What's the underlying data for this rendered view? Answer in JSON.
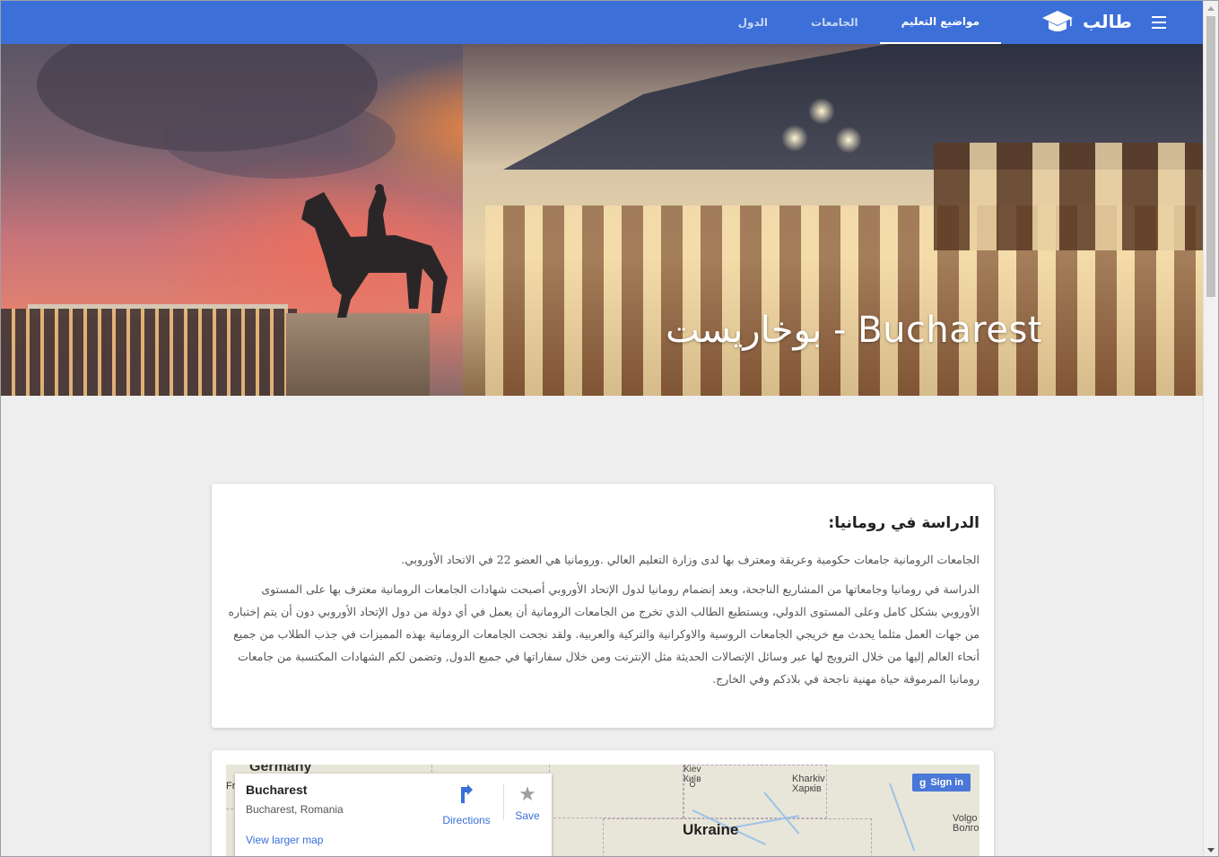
{
  "app": {
    "brand": "طالب",
    "tabs": [
      {
        "label": "مواضيع التعليم",
        "active": true
      },
      {
        "label": "الجامعات",
        "active": false
      },
      {
        "label": "الدول",
        "active": false
      }
    ]
  },
  "hero": {
    "title": "بوخاريست - Bucharest"
  },
  "article": {
    "heading": "الدراسة في رومانيا:",
    "paragraphs": [
      "الجامعات الرومانية جامعات حكومية وعريقة ومعترف بها لدى وزارة التعليم العالي .ورومانيا هي العضو 22 في الاتحاد الأوروبي.",
      "الدراسة في رومانيا وجامعاتها من المشاريع الناجحة، وبعد إنضمام رومانيا لدول الإتحاد الأوروبي أصبحت شهادات الجامعات الرومانية معترف بها على المستوى الأوروبي بشكل كامل وعلى المستوى الدولي، ويستطيع الطالب الذي تخرج من الجامعات الرومانية أن يعمل في أي دولة من دول الإتحاد الأوروبي دون أن يتم إختباره من جهات العمل مثلما يحدث مع خريجي الجامعات الروسية والاوكرانية والتركية والعربية. ولقد نجحت الجامعات الرومانية بهذه المميزات في جذب الطلاب من جميع أنحاء العالم إليها من خلال الترويج لها عبر وسائل الإتصالات الحديثة مثل الإنترنت ومن خلال سفاراتها في جميع الدول, وتضمن لكم الشهادات المكتسبة من جامعات رومانيا المرموقة حياة مهنية ناجحة في بلادكم وفي الخارج."
    ]
  },
  "map": {
    "place_name": "Bucharest",
    "place_address": "Bucharest, Romania",
    "view_larger": "View larger map",
    "directions_label": "Directions",
    "save_label": "Save",
    "signin_label": "Sign in",
    "labels": {
      "germany": "Germany",
      "fr": "Fr",
      "ukraine": "Ukraine",
      "kiev": "Kiev",
      "kiev_local": "Київ",
      "kharkiv": "Kharkiv",
      "kharkiv_local": "Харків",
      "volgo": "Volgo",
      "volgo_local": "Волго"
    }
  },
  "colors": {
    "navbar": "#3c6fd8",
    "link": "#3a6fd8",
    "background": "#eeeeee"
  },
  "icons": {
    "menu": "hamburger-menu-icon",
    "logo": "graduation-cap-icon",
    "directions": "directions-icon",
    "save": "star-icon",
    "signin": "google-g-icon"
  }
}
